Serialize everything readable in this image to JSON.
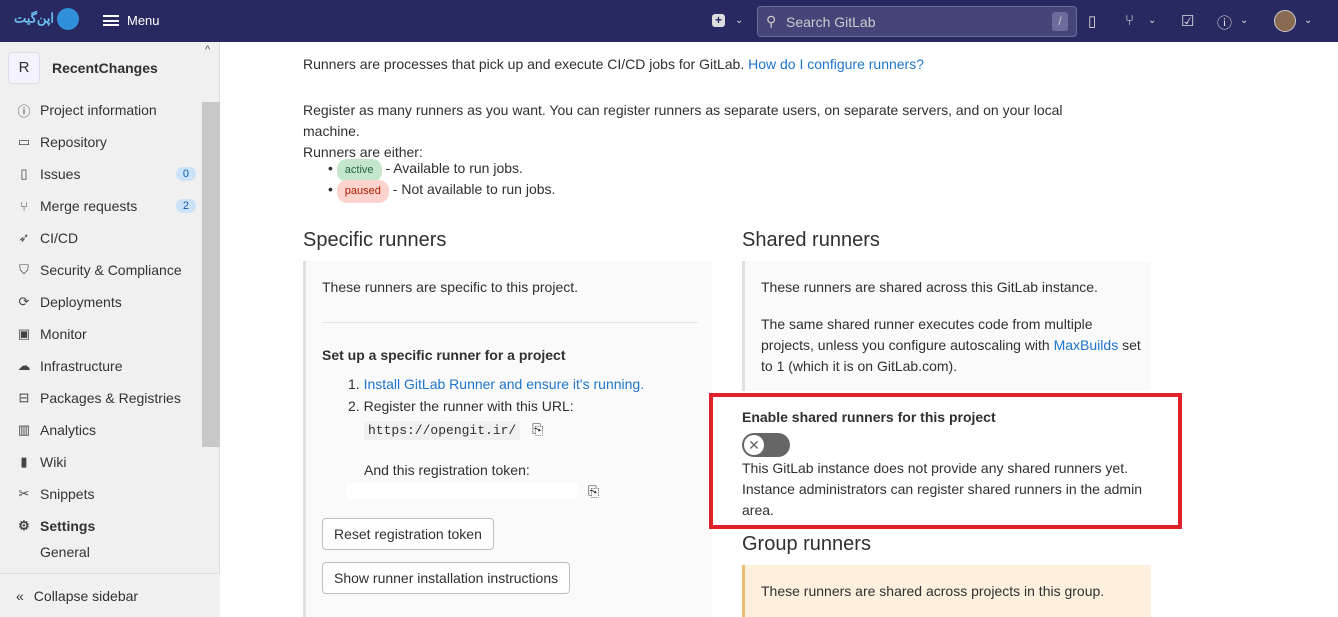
{
  "header": {
    "logo_text": "اپن‌گیت",
    "menu": "Menu",
    "search_placeholder": "Search GitLab",
    "search_shortcut": "/"
  },
  "sidebar": {
    "project_initial": "R",
    "project_name": "RecentChanges",
    "items": [
      {
        "label": "Project information",
        "icon": "info-icon"
      },
      {
        "label": "Repository",
        "icon": "book-icon"
      },
      {
        "label": "Issues",
        "icon": "issues-icon",
        "badge": "0"
      },
      {
        "label": "Merge requests",
        "icon": "merge-request-icon",
        "badge": "2"
      },
      {
        "label": "CI/CD",
        "icon": "rocket-icon"
      },
      {
        "label": "Security & Compliance",
        "icon": "shield-icon"
      },
      {
        "label": "Deployments",
        "icon": "deployments-icon"
      },
      {
        "label": "Monitor",
        "icon": "monitor-icon"
      },
      {
        "label": "Infrastructure",
        "icon": "cloud-icon"
      },
      {
        "label": "Packages & Registries",
        "icon": "package-icon"
      },
      {
        "label": "Analytics",
        "icon": "chart-icon"
      },
      {
        "label": "Wiki",
        "icon": "wiki-icon"
      },
      {
        "label": "Snippets",
        "icon": "snippet-icon"
      },
      {
        "label": "Settings",
        "icon": "gear-icon"
      },
      {
        "label": "General",
        "icon": ""
      }
    ],
    "collapse": "Collapse sidebar"
  },
  "intro": {
    "line1": "Runners are processes that pick up and execute CI/CD jobs for GitLab.",
    "link": "How do I configure runners?",
    "line2": "Register as many runners as you want. You can register runners as separate users, on separate servers, and on your local machine.",
    "line3": "Runners are either:",
    "active": "active",
    "active_desc": "- Available to run jobs.",
    "paused": "paused",
    "paused_desc": "- Not available to run jobs."
  },
  "specific": {
    "title": "Specific runners",
    "desc": "These runners are specific to this project.",
    "setup_title": "Set up a specific runner for a project",
    "step1": "Install GitLab Runner and ensure it's running.",
    "step2": "Register the runner with this URL:",
    "url": "https://opengit.ir/",
    "token_label": "And this registration token:",
    "reset": "Reset registration token",
    "show": "Show runner installation instructions"
  },
  "shared": {
    "title": "Shared runners",
    "desc": "These runners are shared across this GitLab instance.",
    "desc2a": "The same shared runner executes code from multiple projects, unless you configure autoscaling with",
    "maxbuilds": "MaxBuilds",
    "desc2b": "set to 1 (which it is on GitLab.com).",
    "enable_label": "Enable shared runners for this project",
    "enabled": false,
    "none_text": "This GitLab instance does not provide any shared runners yet. Instance administrators can register shared runners in the admin area."
  },
  "group": {
    "title": "Group runners",
    "desc": "These runners are shared across projects in this group."
  }
}
